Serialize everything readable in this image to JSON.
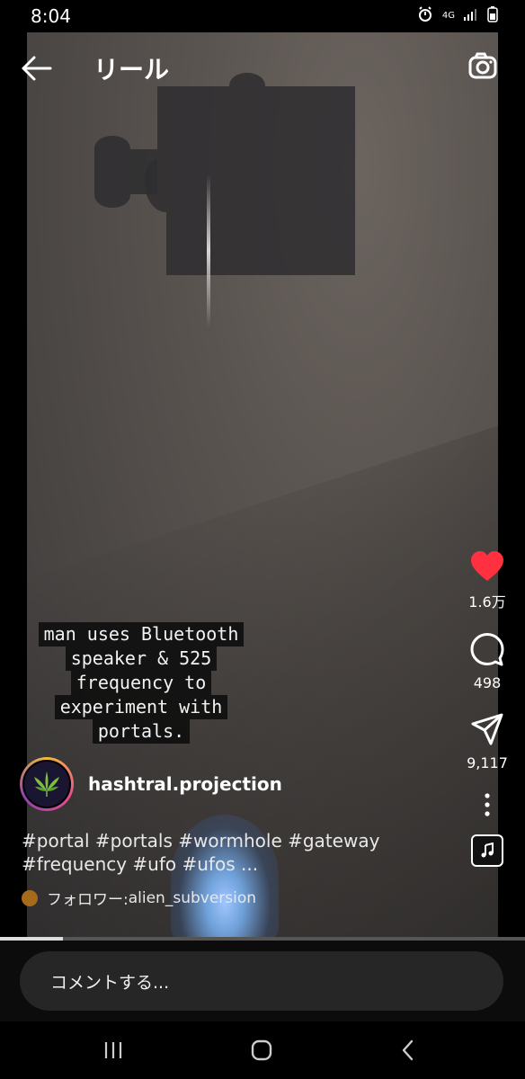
{
  "status_bar": {
    "time": "8:04",
    "network": "4G"
  },
  "header": {
    "title": "リール"
  },
  "video": {
    "caption_lines": [
      "man uses Bluetooth",
      "speaker & 525",
      "frequency to",
      "experiment with",
      "portals."
    ],
    "progress_fraction": 0.12
  },
  "actions": {
    "like_count": "1.6万",
    "comment_count": "498",
    "share_count": "9,117"
  },
  "post": {
    "username": "hashtral.projection",
    "hashtags_line1": "#portal #portals #wormhole #gateway",
    "hashtags_line2": "#frequency #ufo #ufos ...",
    "follower_prefix": "フォロワー: ",
    "follower_name": "alien_subversion"
  },
  "comment": {
    "placeholder": "コメントする..."
  },
  "colors": {
    "like": "#ff3040",
    "background": "#000000"
  }
}
